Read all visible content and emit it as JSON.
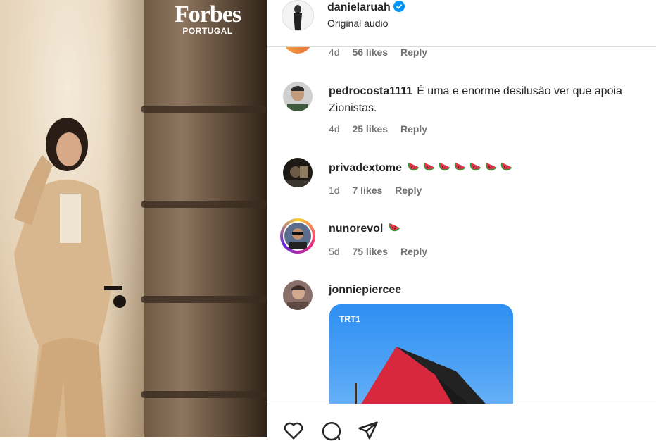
{
  "photo": {
    "brand_main": "Forbes",
    "brand_sub": "PORTUGAL"
  },
  "header": {
    "username": "danielaruah",
    "subtitle": "Original audio"
  },
  "comments": [
    {
      "username": "",
      "text": "",
      "age": "4d",
      "likes": "56 likes",
      "reply": "Reply"
    },
    {
      "username": "pedrocosta1111",
      "text": "É uma e enorme desilusão ver que apoia Zionistas.",
      "age": "4d",
      "likes": "25 likes",
      "reply": "Reply"
    },
    {
      "username": "privadextome",
      "text": "",
      "emoji_count": 7,
      "age": "1d",
      "likes": "7 likes",
      "reply": "Reply"
    },
    {
      "username": "nunorevol",
      "text": "",
      "emoji_count": 1,
      "age": "5d",
      "likes": "75 likes",
      "reply": "Reply"
    },
    {
      "username": "jonniepiercee",
      "text": ""
    }
  ],
  "media": {
    "channel_logo": "TRT1"
  },
  "icons": {
    "like": "heart-icon",
    "comment": "comment-icon",
    "share": "paper-plane-icon",
    "verified": "verified-badge-icon",
    "emoji": "watermelon-emoji"
  },
  "colors": {
    "text": "#262626",
    "meta": "#737373",
    "verified": "#0095f6",
    "divider": "#dbdbdb"
  }
}
